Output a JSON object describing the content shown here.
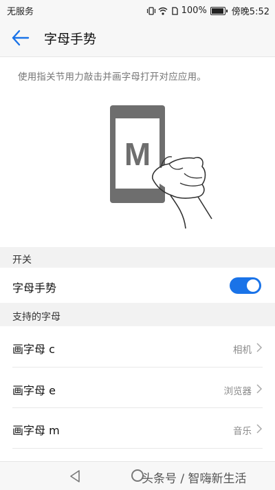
{
  "status_bar": {
    "carrier": "无服务",
    "battery": "100%",
    "time": "傍晚5:52",
    "icons": [
      "vibrate-icon",
      "wifi-icon",
      "sim-icon",
      "battery-icon"
    ]
  },
  "app_bar": {
    "title": "字母手势",
    "back_icon": "arrow-left-icon"
  },
  "description": "使用指关节用力敲击并画字母打开对应应用。",
  "illustration": {
    "letter": "M"
  },
  "sections": {
    "switch_header": "开关",
    "letters_header": "支持的字母"
  },
  "toggle_row": {
    "label": "字母手势",
    "enabled": true
  },
  "letter_rows": [
    {
      "label": "画字母 c",
      "value": "相机"
    },
    {
      "label": "画字母 e",
      "value": "浏览器"
    },
    {
      "label": "画字母 m",
      "value": "音乐"
    }
  ],
  "nav_bar": {
    "watermark": "头条号 / 智嗨新生活"
  },
  "colors": {
    "accent": "#1a73e8",
    "section_bg": "#f2f2f2",
    "secondary_text": "#8a8a8a"
  }
}
